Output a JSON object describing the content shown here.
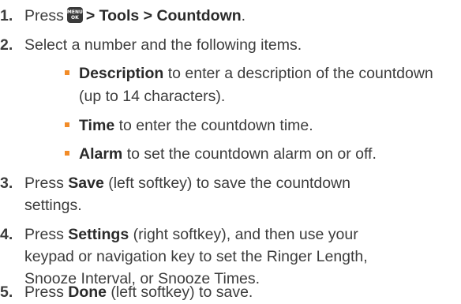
{
  "steps": [
    {
      "number": "1.",
      "pre": "Press",
      "key_top": "MENU",
      "key_bottom": "OK",
      "path": "> Tools > Countdown",
      "post": "."
    },
    {
      "number": "2.",
      "text": "Select a number and the following items.",
      "bullets": [
        {
          "bold": "Description",
          "line1": " to enter a description of the countdown",
          "line2": "(up to 14 characters)."
        },
        {
          "bold": "Time",
          "line1": " to enter the countdown time."
        },
        {
          "bold": "Alarm",
          "line1": " to set the countdown alarm on or off."
        }
      ]
    },
    {
      "number": "3.",
      "pre": "Press ",
      "bold": "Save",
      "line1": " (left softkey) to save the countdown",
      "line2": "settings."
    },
    {
      "number": "4.",
      "pre": "Press ",
      "bold": "Settings",
      "line1": " (right softkey), and then use your",
      "line2": "keypad or navigation key to set the Ringer Length,",
      "line3": "Snooze Interval, or Snooze Times."
    },
    {
      "number": "5.",
      "pre": "Press ",
      "bold": "Done",
      "line1": " (left softkey) to save."
    }
  ],
  "colors": {
    "bullet": "#f28c28",
    "text": "#3c3c3c"
  },
  "icons": {
    "menu_key": "menu-ok-key-icon"
  }
}
